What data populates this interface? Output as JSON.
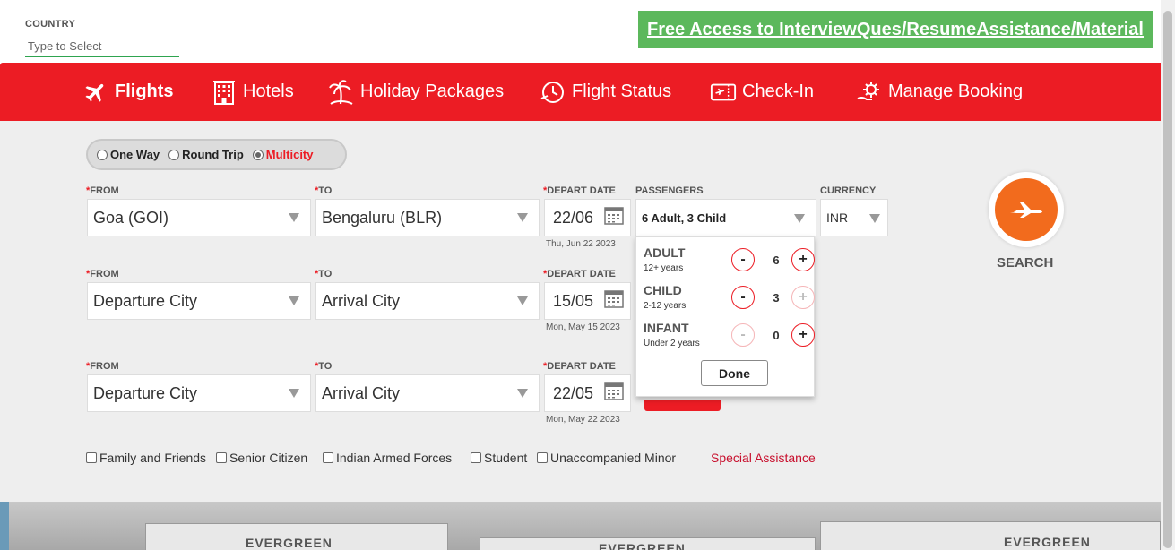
{
  "country": {
    "label": "COUNTRY",
    "placeholder": "Type to Select"
  },
  "promo": {
    "text": "Free Access to InterviewQues/ResumeAssistance/Material"
  },
  "nav": {
    "flights": "Flights",
    "hotels": "Hotels",
    "holiday": "Holiday Packages",
    "status": "Flight Status",
    "checkin": "Check-In",
    "manage": "Manage Booking"
  },
  "trip_type": {
    "one_way": "One Way",
    "round_trip": "Round Trip",
    "multicity": "Multicity",
    "selected": "Multicity"
  },
  "labels": {
    "from": "FROM",
    "to": "TO",
    "depart": "DEPART DATE",
    "passengers": "PASSENGERS",
    "currency": "CURRENCY",
    "required": "*"
  },
  "legs": [
    {
      "from": "Goa (GOI)",
      "to": "Bengaluru (BLR)",
      "date": "22/06",
      "date_full": "Thu, Jun 22 2023"
    },
    {
      "from": "Departure City",
      "to": "Arrival City",
      "date": "15/05",
      "date_full": "Mon, May 15 2023"
    },
    {
      "from": "Departure City",
      "to": "Arrival City",
      "date": "22/05",
      "date_full": "Mon, May 22 2023"
    }
  ],
  "passengers": {
    "summary": "6 Adult, 3 Child",
    "adult": {
      "label": "ADULT",
      "sub": "12+ years",
      "count": "6"
    },
    "child": {
      "label": "CHILD",
      "sub": "2-12 years",
      "count": "3"
    },
    "infant": {
      "label": "INFANT",
      "sub": "Under 2 years",
      "count": "0"
    },
    "minus": "-",
    "plus": "+",
    "done": "Done"
  },
  "currency": {
    "value": "INR"
  },
  "search": {
    "label": "SEARCH"
  },
  "discounts": [
    "Family and Friends",
    "Senior Citizen",
    "Indian Armed Forces",
    "Student",
    "Unaccompanied Minor"
  ],
  "special_assistance": "Special Assistance",
  "banner": {
    "text": "EVERGREEN"
  },
  "colors": {
    "brand_red": "#ec1c24",
    "promo_green": "#5cb85c",
    "search_orange": "#f26b1d",
    "panel_grey": "#eeeeee"
  }
}
